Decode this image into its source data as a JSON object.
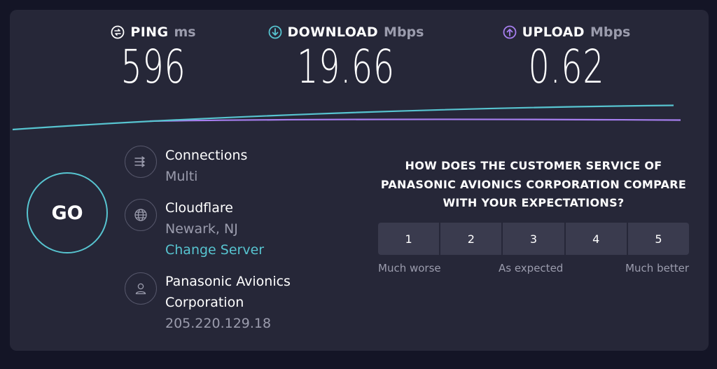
{
  "metrics": {
    "ping": {
      "title": "PING",
      "unit": "ms",
      "value": "596",
      "icon": "ping-icon"
    },
    "download": {
      "title": "DOWNLOAD",
      "unit": "Mbps",
      "value": "19.66",
      "icon": "download-arrow-icon"
    },
    "upload": {
      "title": "UPLOAD",
      "unit": "Mbps",
      "value": "0.62",
      "icon": "upload-arrow-icon"
    }
  },
  "go_label": "GO",
  "connections": {
    "title": "Connections",
    "value": "Multi"
  },
  "server": {
    "name": "Cloudflare",
    "location": "Newark, NJ",
    "change_label": "Change Server"
  },
  "provider": {
    "line1": "Panasonic Avionics",
    "line2": "Corporation",
    "ip": "205.220.129.18"
  },
  "survey": {
    "question_line1": "HOW DOES THE CUSTOMER SERVICE OF",
    "question_line2": "PANASONIC AVIONICS CORPORATION COMPARE",
    "question_line3": "WITH YOUR EXPECTATIONS?",
    "options": [
      "1",
      "2",
      "3",
      "4",
      "5"
    ],
    "low_label": "Much worse",
    "mid_label": "As expected",
    "high_label": "Much better"
  },
  "colors": {
    "background": "#141526",
    "panel": "#262738",
    "download_accent": "#57c4d0",
    "upload_accent": "#a77ff0",
    "muted_text": "#9b9cad",
    "rating_button": "#3a3b4e"
  }
}
